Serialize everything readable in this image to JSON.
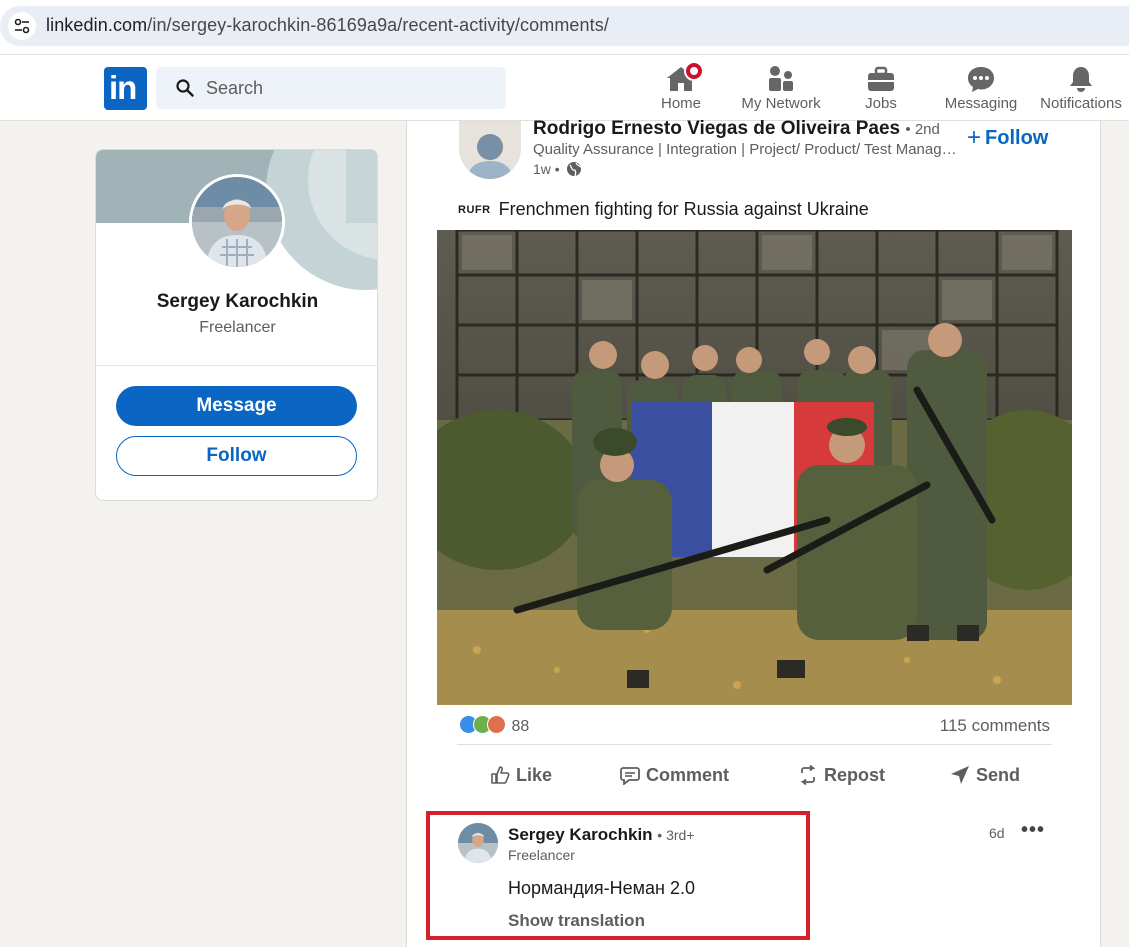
{
  "browser": {
    "url_host": "linkedin.com",
    "url_path": "/in/sergey-karochkin-86169a9a/recent-activity/comments/"
  },
  "nav": {
    "logo": "in",
    "search_placeholder": "Search",
    "items": [
      {
        "label": "Home",
        "icon": "home-icon",
        "badge": true
      },
      {
        "label": "My Network",
        "icon": "network-icon"
      },
      {
        "label": "Jobs",
        "icon": "jobs-icon"
      },
      {
        "label": "Messaging",
        "icon": "messaging-icon"
      },
      {
        "label": "Notifications",
        "icon": "bell-icon"
      }
    ]
  },
  "profile": {
    "name": "Sergey Karochkin",
    "title": "Freelancer",
    "message_label": "Message",
    "follow_label": "Follow"
  },
  "post": {
    "author": "Rodrigo Ernesto Viegas de Oliveira Paes",
    "degree": "• 2nd",
    "headline": "Quality Assurance | Integration | Project/ Product/ Test Management",
    "time": "1w •",
    "follow_label": "Follow",
    "lang_tag": "RUFR",
    "text": "Frenchmen fighting for Russia against Ukraine",
    "reaction_count": "88",
    "comments_count": "115 comments",
    "actions": {
      "like": "Like",
      "comment": "Comment",
      "repost": "Repost",
      "send": "Send"
    }
  },
  "comment": {
    "author": "Sergey Karochkin",
    "degree": "• 3rd+",
    "title": "Freelancer",
    "time": "6d",
    "more": "•••",
    "text": "Нормандия-Неман 2.0",
    "translate": "Show translation"
  },
  "colors": {
    "linkedin_blue": "#0a66c2",
    "highlight_red": "#d3212b",
    "notification_red": "#cb112d",
    "page_bg": "#f4f2ee"
  }
}
